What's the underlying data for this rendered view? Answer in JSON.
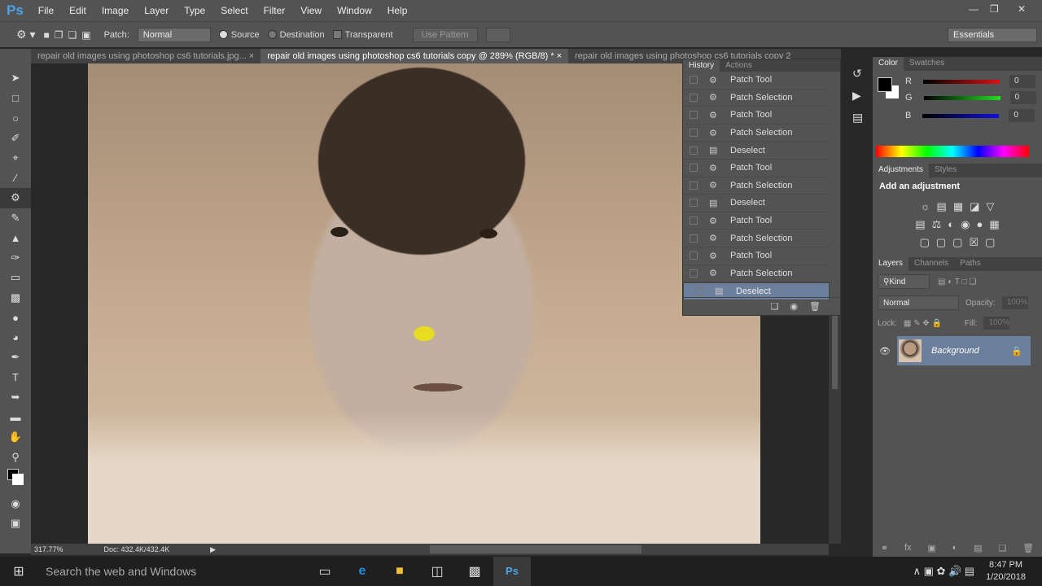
{
  "app": {
    "logo": "Ps",
    "menu": [
      "File",
      "Edit",
      "Image",
      "Layer",
      "Type",
      "Select",
      "Filter",
      "View",
      "Window",
      "Help"
    ]
  },
  "options": {
    "patch_label": "Patch:",
    "patch_mode": "Normal",
    "source": "Source",
    "destination": "Destination",
    "transparent": "Transparent",
    "use_pattern": "Use Pattern",
    "workspace": "Essentials"
  },
  "tabs": [
    {
      "label": "repair old images using photoshop cs6 tutorials.jpg...",
      "active": false
    },
    {
      "label": "repair old images using photoshop cs6 tutorials copy @ 289% (RGB/8) *",
      "active": true
    },
    {
      "label": "repair old images using photoshop cs6 tutorials copy 2",
      "active": false
    }
  ],
  "history": {
    "tabs": [
      "History",
      "Actions"
    ],
    "items": [
      "Patch Tool",
      "Patch Selection",
      "Patch Tool",
      "Patch Selection",
      "Deselect",
      "Patch Tool",
      "Patch Selection",
      "Deselect",
      "Patch Tool",
      "Patch Selection",
      "Patch Tool",
      "Patch Selection",
      "Deselect"
    ]
  },
  "color": {
    "tabs": [
      "Color",
      "Swatches"
    ],
    "r": "0",
    "g": "0",
    "b": "0",
    "r_label": "R",
    "g_label": "G",
    "b_label": "B",
    "foreground": "#000000",
    "background": "#ffffff"
  },
  "adjustments": {
    "tabs": [
      "Adjustments",
      "Styles"
    ],
    "title": "Add an adjustment"
  },
  "layers": {
    "tabs": [
      "Layers",
      "Channels",
      "Paths"
    ],
    "kind": "Kind",
    "blend": "Normal",
    "opacity_label": "Opacity:",
    "opacity": "100%",
    "lock_label": "Lock:",
    "fill_label": "Fill:",
    "fill": "100%",
    "layer_name": "Background"
  },
  "status": {
    "zoom": "317.77%",
    "doc": "Doc: 432.4K/432.4K"
  },
  "taskbar": {
    "search": "Search the web and Windows",
    "time": "8:47 PM",
    "date": "1/20/2018"
  }
}
